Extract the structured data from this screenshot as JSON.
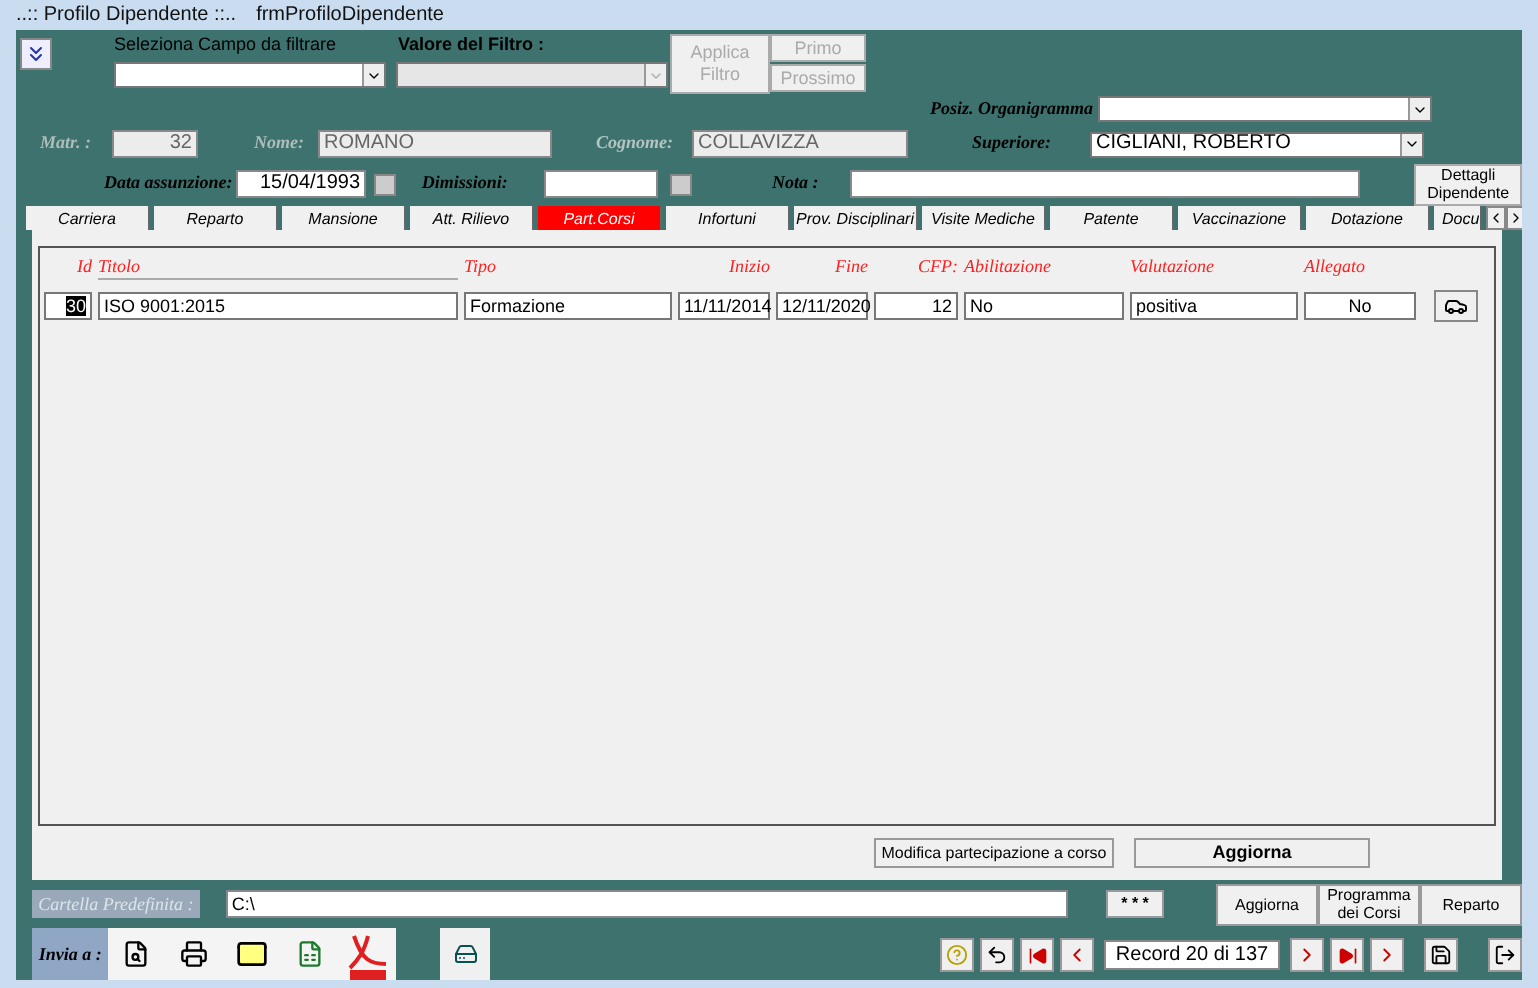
{
  "window": {
    "title": "..:: Profilo Dipendente ::..",
    "form_name": "frmProfiloDipendente"
  },
  "filter": {
    "field_label": "Seleziona Campo da filtrare",
    "value_label": "Valore del Filtro :",
    "value_disabled": true,
    "apply_button": {
      "label": "Applica Filtro",
      "disabled": true
    },
    "first_button": {
      "label": "Primo",
      "disabled": true
    },
    "next_button": {
      "label": "Prossimo",
      "disabled": true
    }
  },
  "employee": {
    "matr_label": "Matr. :",
    "matr": "32",
    "nome_label": "Nome:",
    "nome": "ROMANO",
    "cognome_label": "Cognome:",
    "cognome": "COLLAVIZZA",
    "posiz_label": "Posiz. Organigramma",
    "superiore_label": "Superiore:",
    "superiore": "CIGLIANI, ROBERTO",
    "assunzione_label": "Data assunzione:",
    "assunzione": "15/04/1993",
    "dimissioni_label": "Dimissioni:",
    "nota_label": "Nota :",
    "details_button": "Dettagli Dipendente"
  },
  "tabs": [
    {
      "label": "Carriera",
      "selected": false
    },
    {
      "label": "Reparto",
      "selected": false
    },
    {
      "label": "Mansione",
      "selected": false
    },
    {
      "label": "Att. Rilievo",
      "selected": false
    },
    {
      "label": "Part.Corsi",
      "selected": true
    },
    {
      "label": "Infortuni",
      "selected": false
    },
    {
      "label": "Prov. Disciplinari",
      "selected": false
    },
    {
      "label": "Visite Mediche",
      "selected": false
    },
    {
      "label": "Patente",
      "selected": false
    },
    {
      "label": "Vaccinazione",
      "selected": false
    },
    {
      "label": "Dotazione",
      "selected": false
    },
    {
      "label": "Docu",
      "selected": false
    }
  ],
  "grid": {
    "columns": [
      "Id",
      "Titolo",
      "Tipo",
      "Inizio",
      "Fine",
      "CFP:",
      "Abilitazione",
      "Valutazione",
      "Allegato"
    ],
    "rows": [
      {
        "cells": [
          "30",
          "ISO 9001:2015",
          "Formazione",
          "11/11/2014",
          "12/11/2020",
          "12",
          "No",
          "positiva",
          "No"
        ]
      }
    ]
  },
  "actions": [
    "Modifica  partecipazione a corso",
    "Aggiorna"
  ],
  "folder": {
    "label": "Cartella Predefinita :",
    "value": "C:\\",
    "browse": "* * *"
  },
  "side_buttons": [
    "Aggiorna",
    "Programma dei Corsi",
    "Reparto"
  ],
  "send": {
    "label": "Invia a :"
  },
  "navigator": {
    "record": "Record 20 di 137"
  }
}
